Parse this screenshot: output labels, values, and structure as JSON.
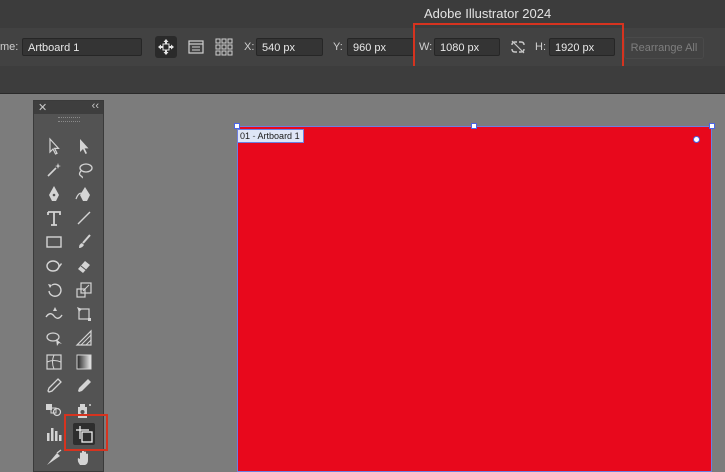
{
  "app": {
    "title": "Adobe Illustrator 2024"
  },
  "controlbar": {
    "name_label": "me:",
    "name_value": "Artboard 1",
    "x_label": "X:",
    "x_value": "540 px",
    "y_label": "Y:",
    "y_value": "960 px",
    "w_label": "W:",
    "w_value": "1080 px",
    "h_label": "H:",
    "h_value": "1920 px",
    "rearrange_label": "Rearrange All"
  },
  "artboard": {
    "number": "01",
    "separator": "-",
    "name": "Artboard 1",
    "fill_color": "#e8081c"
  },
  "tools": {
    "close_glyph": "✕",
    "collapse_glyph": "‹‹",
    "items": [
      "selection-tool",
      "direct-selection-tool",
      "magic-wand-tool",
      "lasso-tool",
      "pen-tool",
      "curvature-tool",
      "type-tool",
      "line-segment-tool",
      "rectangle-tool",
      "paintbrush-tool",
      "shaper-tool",
      "eraser-tool",
      "rotate-tool",
      "scale-tool",
      "width-tool",
      "free-transform-tool",
      "shape-builder-tool",
      "perspective-grid-tool",
      "mesh-tool",
      "gradient-tool",
      "eyedropper-tool",
      "eyedropper-measure-tool",
      "blend-tool",
      "symbol-sprayer-tool",
      "column-graph-tool",
      "artboard-tool",
      "slice-tool",
      "hand-tool"
    ],
    "active": "artboard-tool"
  },
  "highlights": {
    "color": "#d6331f"
  }
}
